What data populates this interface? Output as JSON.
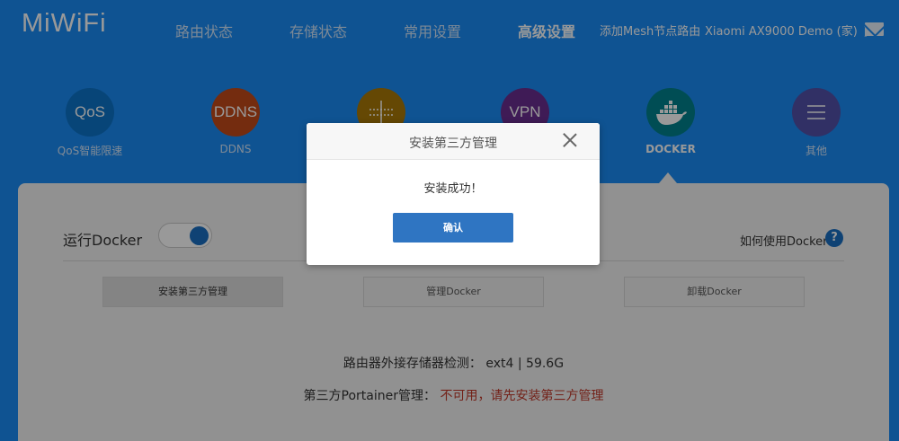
{
  "header": {
    "logo": "MiWiFi",
    "nav": [
      {
        "label": "路由状态"
      },
      {
        "label": "存储状态"
      },
      {
        "label": "常用设置"
      },
      {
        "label": "高级设置",
        "active": true
      }
    ],
    "mesh_label": "添加Mesh节点路由",
    "device_label": "Xiaomi AX9000 Demo (家)"
  },
  "features": [
    {
      "label": "QoS智能限速",
      "icon": "QoS",
      "color": "#0d73c9"
    },
    {
      "label": "DDNS",
      "icon": "DDNS",
      "color": "#c24a1a"
    },
    {
      "label": "",
      "icon": "port-forward-icon",
      "color": "#a97807"
    },
    {
      "label": "",
      "icon": "VPN",
      "color": "#6a2d8f"
    },
    {
      "label": "DOCKER",
      "icon": "docker-icon",
      "color": "#00808c",
      "active": true
    },
    {
      "label": "其他",
      "icon": "menu-icon",
      "color": "#5250a8"
    }
  ],
  "panel": {
    "run_label": "运行Docker",
    "toggle_on": true,
    "help_text": "如何使用Docker",
    "buttons": [
      {
        "label": "安装第三方管理"
      },
      {
        "label": "管理Docker"
      },
      {
        "label": "卸载Docker"
      }
    ],
    "storage_label": "路由器外接存储器检测：",
    "storage_value": "ext4 | 59.6G",
    "portainer_label": "第三方Portainer管理：",
    "portainer_value": "不可用，请先安装第三方管理"
  },
  "modal": {
    "title": "安装第三方管理",
    "message": "安装成功！",
    "confirm": "确认"
  }
}
